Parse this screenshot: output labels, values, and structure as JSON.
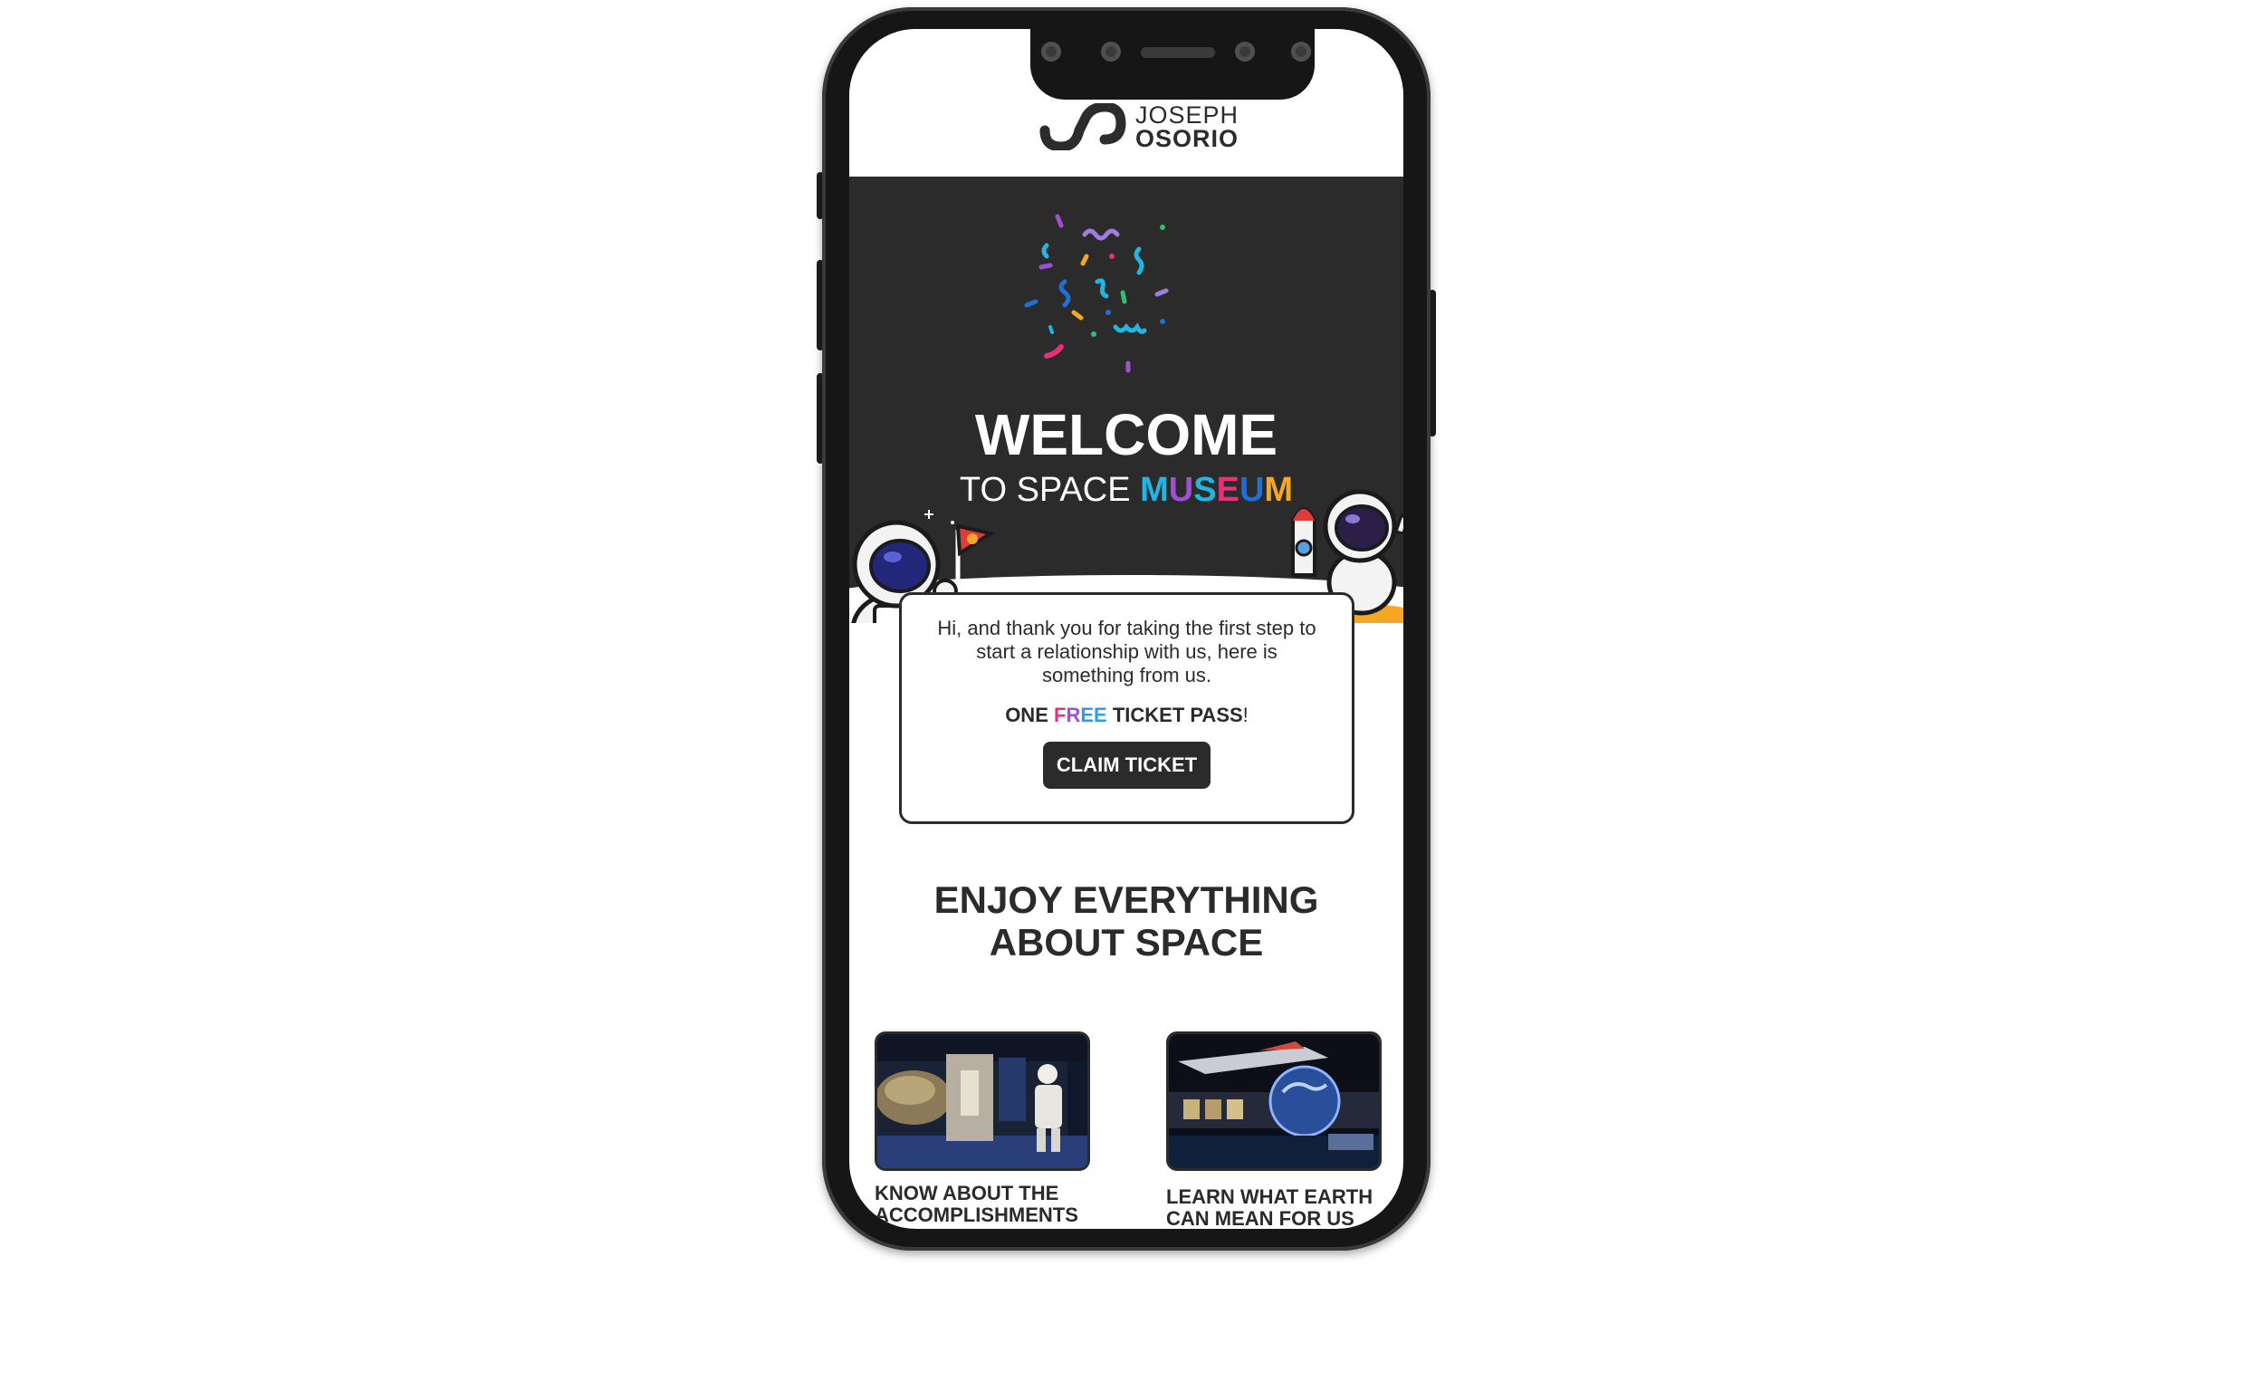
{
  "logo": {
    "line1": "JOSEPH",
    "line2": "OSORIO"
  },
  "hero": {
    "title": "WELCOME",
    "subtitle_prefix": "TO SPACE",
    "subtitle_accent": [
      "M",
      "U",
      "S",
      "E",
      "U",
      "M"
    ],
    "accent_colors": [
      "#1fb7e8",
      "#a04fd6",
      "#20b6e0",
      "#e8317a",
      "#1f6fd6",
      "#f5a623"
    ]
  },
  "card": {
    "message": "Hi, and thank you for taking the first step to start a relationship with us, here is something from us.",
    "ticket_prefix": "ONE",
    "ticket_accent": [
      "F",
      "R",
      "E",
      "E"
    ],
    "ticket_accent_colors": [
      "#e8317a",
      "#a04fd6",
      "#2f9de0",
      "#2f9de0"
    ],
    "ticket_suffix": "TICKET PASS",
    "ticket_end": "!",
    "button_label": "CLAIM TICKET"
  },
  "section": {
    "title_line1": "ENJOY EVERYTHING",
    "title_line2": "ABOUT SPACE"
  },
  "tiles": [
    {
      "caption_line1": "KNOW ABOUT THE",
      "caption_line2": "ACCOMPLISHMENTS",
      "image": "moon-landing-exhibit"
    },
    {
      "caption_line1": "LEARN WHAT EARTH",
      "caption_line2": "CAN MEAN FOR US",
      "image": "earth-globe-exhibit"
    }
  ]
}
